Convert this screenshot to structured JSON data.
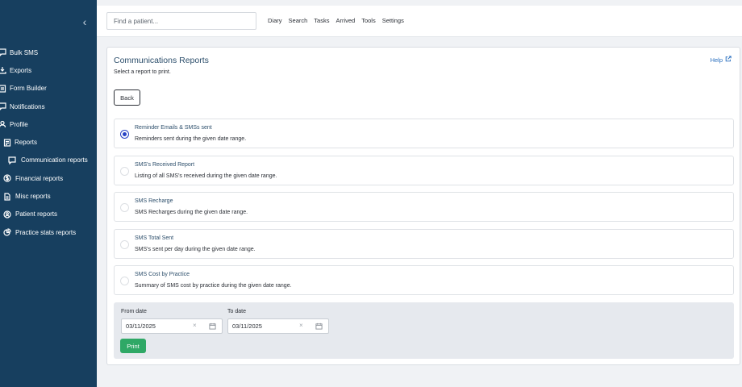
{
  "sidebar": {
    "collapse_icon": "chevron-left-icon",
    "items": [
      {
        "label": "Bulk SMS",
        "icon": "chat-icon"
      },
      {
        "label": "Exports",
        "icon": "download-icon"
      },
      {
        "label": "Form Builder",
        "icon": "form-icon"
      },
      {
        "label": "Notifications",
        "icon": "bell-icon"
      },
      {
        "label": "Profile",
        "icon": "user-icon"
      },
      {
        "label": "Reports",
        "icon": "report-icon"
      },
      {
        "label": "Communication reports",
        "icon": "chat-icon"
      },
      {
        "label": "Financial reports",
        "icon": "dollar-icon"
      },
      {
        "label": "Misc reports",
        "icon": "file-icon"
      },
      {
        "label": "Patient reports",
        "icon": "user-circle-icon"
      },
      {
        "label": "Practice stats reports",
        "icon": "pie-chart-icon"
      }
    ]
  },
  "header": {
    "search_placeholder": "Find a patient...",
    "nav": [
      "Diary",
      "Search",
      "Tasks",
      "Arrived",
      "Tools",
      "Settings"
    ]
  },
  "card": {
    "title": "Communications Reports",
    "help_label": "Help",
    "subtitle": "Select a report to print.",
    "back_label": "Back",
    "options": [
      {
        "title": "Reminder Emails & SMSs sent",
        "desc": "Reminders sent during the given date range.",
        "selected": true
      },
      {
        "title": "SMS's Received Report",
        "desc": "Listing of all SMS's received during the given date range.",
        "selected": false
      },
      {
        "title": "SMS Recharge",
        "desc": "SMS Recharges during the given date range.",
        "selected": false
      },
      {
        "title": "SMS Total Sent",
        "desc": "SMS's sent per day during the given date range.",
        "selected": false
      },
      {
        "title": "SMS Cost by Practice",
        "desc": "Summary of SMS cost by practice during the given date range.",
        "selected": false
      }
    ],
    "from_label": "From date",
    "from_value": "03/11/2025",
    "to_label": "To date",
    "to_value": "03/11/2025",
    "print_label": "Print"
  },
  "colors": {
    "sidebar_bg": "#173f5f",
    "accent_blue": "#2742c4",
    "print_green": "#2fa866",
    "link_blue": "#2a6fbf"
  }
}
